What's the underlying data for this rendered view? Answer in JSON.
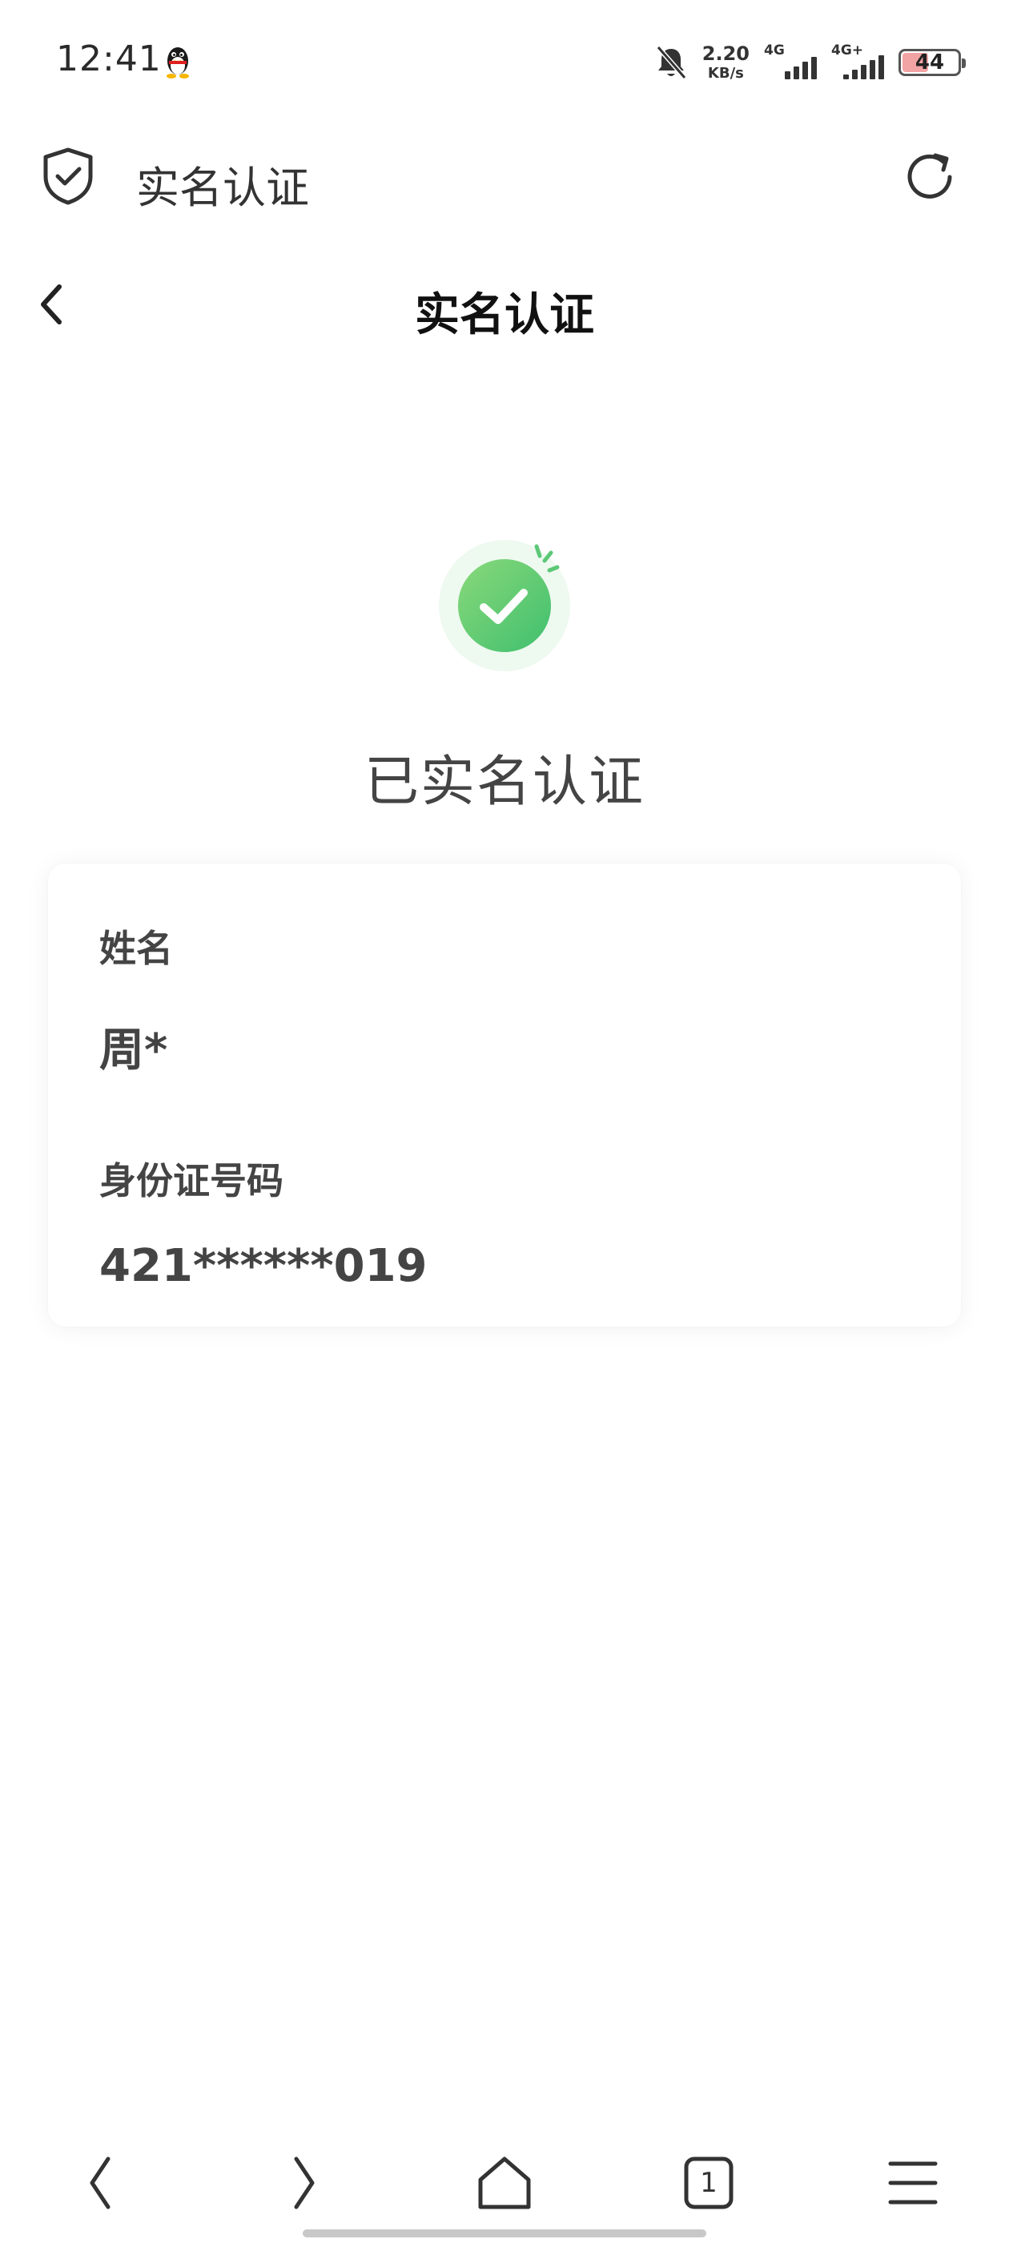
{
  "status_bar": {
    "time": "12:41",
    "net_speed_value": "2.20",
    "net_speed_unit": "KB/s",
    "sim1_label": "4G",
    "sim2_label": "4G+",
    "battery_level": "44",
    "battery_color": "#f2a3a3"
  },
  "browser": {
    "title": "实名认证",
    "icons": [
      "shield-check-icon",
      "refresh-icon"
    ]
  },
  "page": {
    "title": "实名认证",
    "status_text": "已实名认证",
    "accent_color": "#4cc46a"
  },
  "card": {
    "name_label": "姓名",
    "name_value": "周*",
    "id_label": "身份证号码",
    "id_value": "421******019"
  },
  "bottom_nav": {
    "tab_count": "1",
    "icons": [
      "back-icon",
      "forward-icon",
      "home-icon",
      "tabs-icon",
      "menu-icon"
    ]
  }
}
